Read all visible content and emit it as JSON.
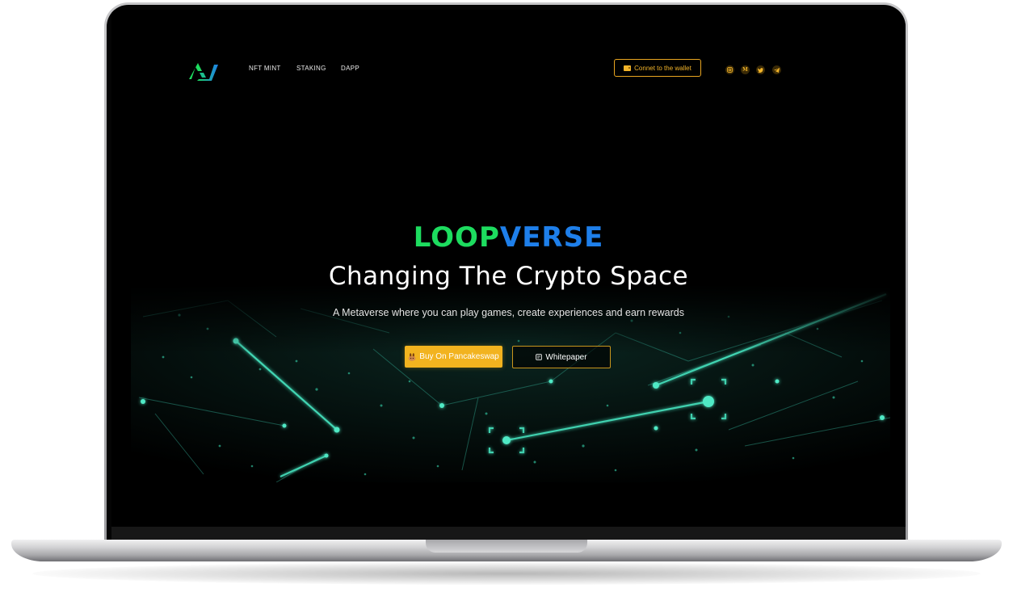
{
  "nav": {
    "links": [
      {
        "label": "NFT MINT"
      },
      {
        "label": "STAKING"
      },
      {
        "label": "DAPP"
      }
    ],
    "wallet_button": "Connet to the wallet",
    "socials": [
      "instagram-icon",
      "medium-icon",
      "twitter-icon",
      "telegram-icon"
    ],
    "medium_letter": "M"
  },
  "hero": {
    "brand_part1": "LOOP",
    "brand_part2": "VERSE",
    "headline": "Changing The Crypto Space",
    "subline": "A Metaverse where you can play games, create experiences and earn rewards",
    "buy_button": "Buy On Pancakeswap",
    "whitepaper_button": "Whitepaper"
  },
  "colors": {
    "brand_green": "#1ddc5f",
    "brand_blue": "#1e7fea",
    "accent_gold": "#f2b31f",
    "background": "#000000",
    "network_teal": "#3fd6b0"
  }
}
